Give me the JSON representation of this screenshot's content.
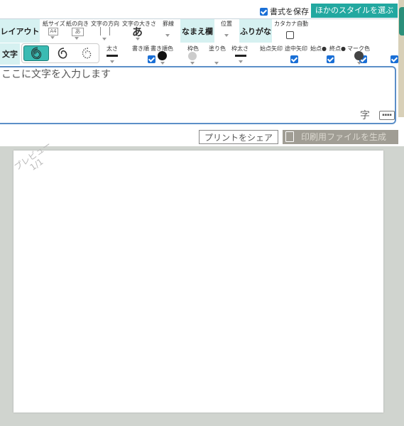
{
  "top": {
    "save_format_label": "書式を保存",
    "save_format_checked": true,
    "other_style_label": "ほかのスタイルを選ぶ"
  },
  "toolbar": {
    "layout_section": "レイアウト",
    "paper_size_label": "紙サイズ",
    "paper_size_value": "A4",
    "paper_orientation_label": "紙の向き",
    "paper_orientation_value": "あ",
    "text_direction_label": "文字の方向",
    "text_size_label": "文字の大きさ",
    "text_size_value": "あ",
    "ruled_lines_label": "罫線",
    "name_section": "なまえ欄",
    "position_label": "位置",
    "furigana_section": "ふりがな",
    "katakana_auto_label": "カタカナ自動",
    "katakana_auto_checked": false,
    "text_section": "文字",
    "thickness_label": "太さ",
    "stroke_order_label": "書き順",
    "stroke_order_checked": true,
    "stroke_order_color_label": "書き順色",
    "frame_color_label": "枠色",
    "fill_color_label": "塗り色",
    "frame_thickness_label": "枠太さ",
    "start_arrow_label": "始点矢印",
    "start_arrow_checked": true,
    "mid_arrow_label": "途中矢印",
    "mid_arrow_checked": true,
    "start_dot_label": "始点●",
    "start_dot_checked": true,
    "end_dot_label": "終点●",
    "end_dot_checked": true,
    "mark_color_label": "マーク色",
    "colors": {
      "section_bg": "#d6f1f1",
      "accent": "#22a8a0",
      "checkbox": "#1a6fd6",
      "stroke_order_color": "#111111",
      "frame_color": "#cccccc",
      "mark_color": "#444444"
    }
  },
  "editor": {
    "placeholder": "ここに文字を入力します",
    "handwriting_icon": "字",
    "keyboard_icon": "keyboard-icon"
  },
  "actions": {
    "share_print_label": "プリントをシェア",
    "generate_file_label": "印刷用ファイルを生成"
  },
  "preview": {
    "watermark_line1": "プレビュー",
    "watermark_line2": "1/1"
  }
}
